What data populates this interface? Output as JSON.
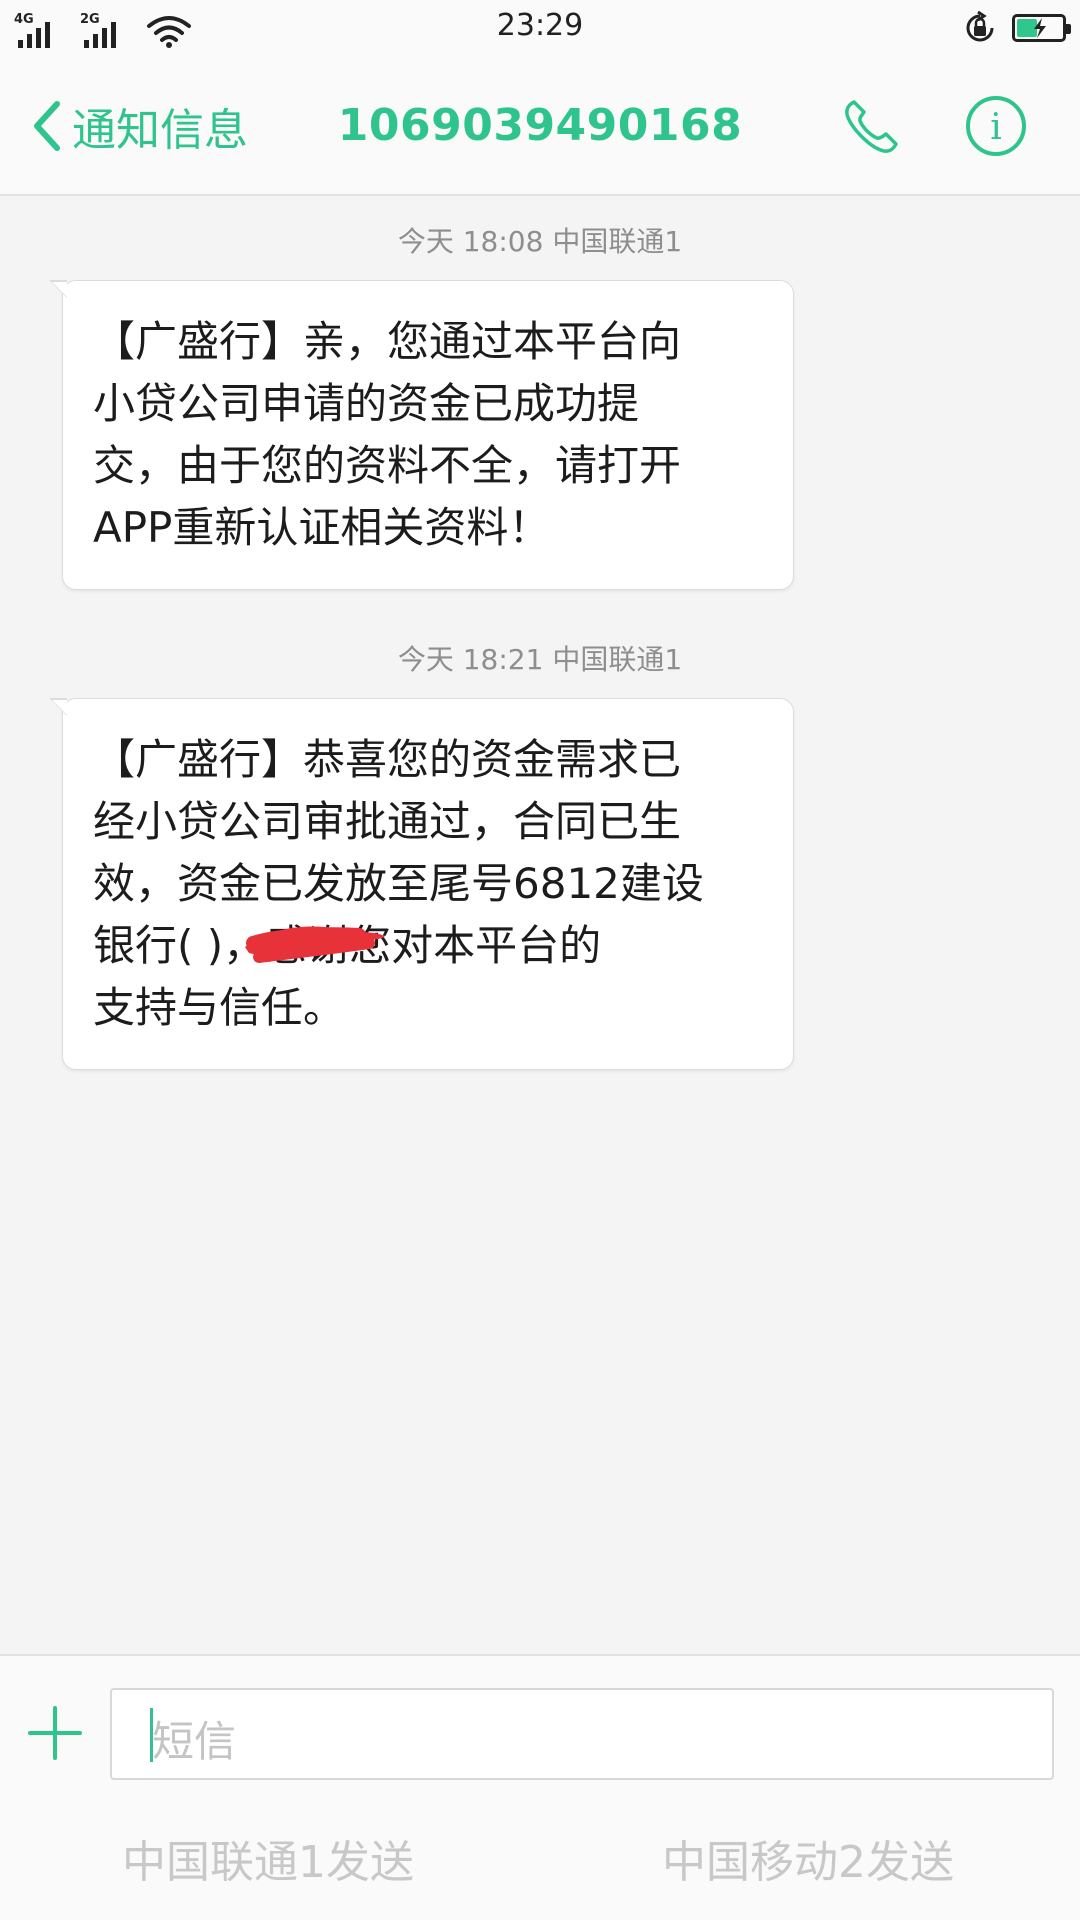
{
  "status_bar": {
    "time": "23:29",
    "sim1_network": "4G",
    "sim2_network": "2G",
    "battery_level_fraction": 0.45,
    "icons": [
      "signal-icon",
      "wifi-icon",
      "rotation-lock-icon",
      "battery-charging-icon"
    ]
  },
  "header": {
    "back_label": "通知信息",
    "contact_number": "1069039490168",
    "icons": [
      "chevron-left-icon",
      "phone-icon",
      "info-icon"
    ]
  },
  "messages": [
    {
      "meta": "今天 18:08  中国联通1",
      "lines": [
        "【广盛行】亲，您通过本平台向",
        "小贷公司申请的资金已成功提",
        "交，由于您的资料不全，请打开",
        "APP重新认证相关资料！"
      ]
    },
    {
      "meta": "今天 18:21  中国联通1",
      "lines": [
        "【广盛行】恭喜您的资金需求已",
        "经小贷公司审批通过，合同已生",
        "效，资金已发放至尾号6812建设",
        "银行(      )，感谢您对本平台的",
        "支持与信任。"
      ]
    }
  ],
  "composer": {
    "placeholder": "短信",
    "send_sim1": "中国联通1发送",
    "send_sim2": "中国移动2发送"
  },
  "colors": {
    "accent": "#2fc48d",
    "background": "#f4f4f4",
    "bubble": "#ffffff",
    "redaction": "#e8323a"
  }
}
